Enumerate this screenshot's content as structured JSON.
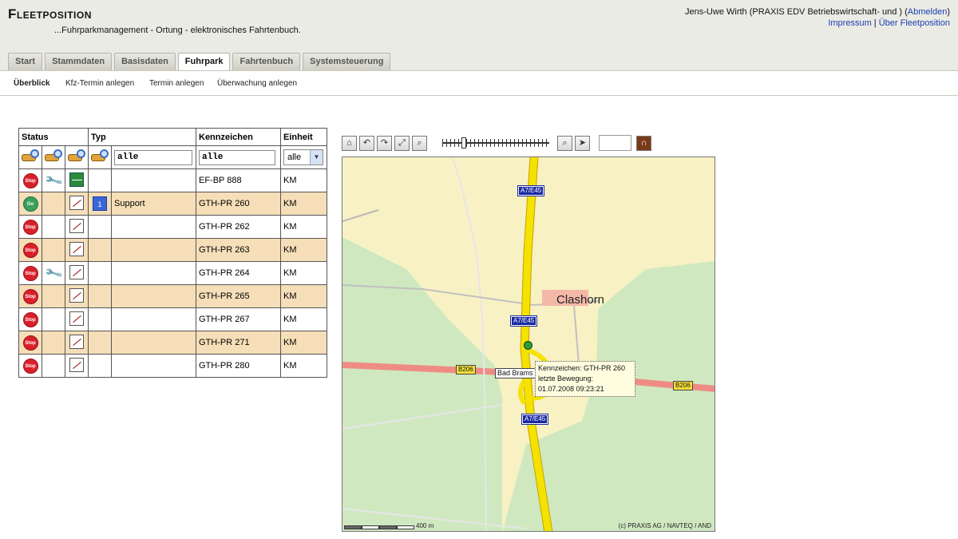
{
  "app": {
    "title": "Fleetposition",
    "subtitle": "...Fuhrparkmanagement - Ortung - elektronisches Fahrtenbuch."
  },
  "user": {
    "name": "Jens-Uwe Wirth (PRAXIS EDV Betriebswirtschaft- und ) (",
    "logout": "Abmelden",
    "closing": ")",
    "impressum": "Impressum",
    "separator": " | ",
    "about": "Über Fleetposition"
  },
  "tabs": [
    {
      "label": "Start"
    },
    {
      "label": "Stammdaten"
    },
    {
      "label": "Basisdaten"
    },
    {
      "label": "Fuhrpark",
      "active": true
    },
    {
      "label": "Fahrtenbuch"
    },
    {
      "label": "Systemsteuerung"
    }
  ],
  "subnav": [
    {
      "label": "Überblick",
      "active": true
    },
    {
      "label": "Kfz-Termin anlegen"
    },
    {
      "label": "Termin anlegen"
    },
    {
      "label": "Überwachung anlegen"
    }
  ],
  "table": {
    "headers": {
      "status": "Status",
      "typ": "Typ",
      "kennzeichen": "Kennzeichen",
      "einheit": "Einheit"
    },
    "filters": {
      "typ": "alle",
      "kennzeichen": "alle",
      "einheit": "alle"
    },
    "rows": [
      {
        "status": "Stop",
        "wrench": true,
        "box": "green",
        "num": "",
        "typ": "",
        "kennzeichen": "EF-BP 888",
        "einheit": "KM"
      },
      {
        "status": "Go",
        "wrench": false,
        "box": "normal",
        "num": "1",
        "typ": "Support",
        "kennzeichen": "GTH-PR 260",
        "einheit": "KM"
      },
      {
        "status": "Stop",
        "wrench": false,
        "box": "normal",
        "num": "",
        "typ": "",
        "kennzeichen": "GTH-PR 262",
        "einheit": "KM"
      },
      {
        "status": "Stop",
        "wrench": false,
        "box": "normal",
        "num": "",
        "typ": "",
        "kennzeichen": "GTH-PR 263",
        "einheit": "KM"
      },
      {
        "status": "Stop",
        "wrench": true,
        "box": "normal",
        "num": "",
        "typ": "",
        "kennzeichen": "GTH-PR 264",
        "einheit": "KM"
      },
      {
        "status": "Stop",
        "wrench": false,
        "box": "normal",
        "num": "",
        "typ": "",
        "kennzeichen": "GTH-PR 265",
        "einheit": "KM"
      },
      {
        "status": "Stop",
        "wrench": false,
        "box": "normal",
        "num": "",
        "typ": "",
        "kennzeichen": "GTH-PR 267",
        "einheit": "KM"
      },
      {
        "status": "Stop",
        "wrench": false,
        "box": "normal",
        "num": "",
        "typ": "",
        "kennzeichen": "GTH-PR 271",
        "einheit": "KM"
      },
      {
        "status": "Stop",
        "wrench": false,
        "box": "normal",
        "num": "",
        "typ": "",
        "kennzeichen": "GTH-PR 280",
        "einheit": "KM"
      }
    ]
  },
  "map": {
    "toolbar": [
      "home-icon",
      "back-icon",
      "forward-icon",
      "fullscreen-icon",
      "zoom-in-icon",
      "zoom-out-icon",
      "locate-icon",
      "tunnel-icon"
    ],
    "labels": {
      "a7_1": "A7/E45",
      "a7_2": "A7/E45",
      "a7_3": "A7/E45",
      "b206_1": "B206",
      "b206_2": "B206",
      "bad_bramstedt": "Bad Brams",
      "clashorn": "Clashorn"
    },
    "popup": {
      "line1": "Kennzeichen: GTH-PR 260",
      "line2": "letzte Bewegung:",
      "line3": "01.07.2008 09:23:21"
    },
    "scale": "400 m",
    "copyright": "(c) PRAXIS AG / NAVTEQ / AND"
  }
}
